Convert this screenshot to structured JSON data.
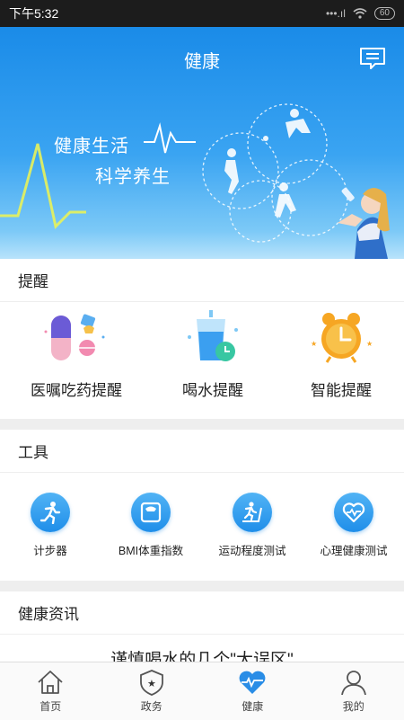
{
  "status": {
    "time": "下午5:32",
    "battery": "60"
  },
  "header": {
    "title": "健康"
  },
  "banner": {
    "line1": "健康生活",
    "line2": "科学养生"
  },
  "reminders": {
    "title": "提醒",
    "items": [
      {
        "label": "医嘱吃药提醒",
        "icon": "pill-icon"
      },
      {
        "label": "喝水提醒",
        "icon": "water-cup-icon"
      },
      {
        "label": "智能提醒",
        "icon": "alarm-clock-icon"
      }
    ]
  },
  "tools": {
    "title": "工具",
    "items": [
      {
        "label": "计步器",
        "icon": "running-person-icon"
      },
      {
        "label": "BMI体重指数",
        "icon": "scale-icon"
      },
      {
        "label": "运动程度测试",
        "icon": "treadmill-icon"
      },
      {
        "label": "心理健康测试",
        "icon": "heart-pulse-icon"
      }
    ]
  },
  "news": {
    "title": "健康资讯",
    "peek": "谨慎喝水的几个\"大误区\""
  },
  "tabs": [
    {
      "label": "首页",
      "icon": "home-icon"
    },
    {
      "label": "政务",
      "icon": "government-badge-icon"
    },
    {
      "label": "健康",
      "icon": "health-heart-icon",
      "active": true
    },
    {
      "label": "我的",
      "icon": "profile-icon"
    }
  ],
  "colors": {
    "primary": "#1f8ee9",
    "banner_top": "#1a8be8"
  }
}
